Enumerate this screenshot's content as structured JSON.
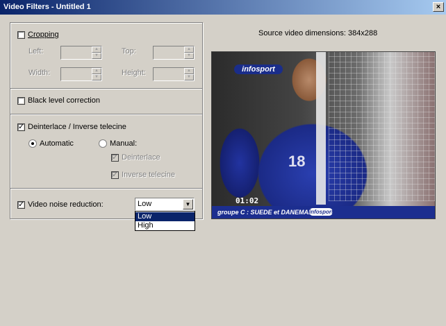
{
  "window": {
    "title": "Video Filters - Untitled 1",
    "close_glyph": "×"
  },
  "cropping": {
    "label": "Cropping",
    "checked": false,
    "left_label": "Left:",
    "top_label": "Top:",
    "width_label": "Width:",
    "height_label": "Height:",
    "left_value": "",
    "top_value": "",
    "width_value": "",
    "height_value": ""
  },
  "black_level": {
    "label": "Black level correction",
    "checked": false
  },
  "deinterlace": {
    "label": "Deinterlace / Inverse telecine",
    "checked": true,
    "automatic_label": "Automatic",
    "manual_label": "Manual:",
    "selected_mode": "Automatic",
    "deinterlace_label": "Deinterlace",
    "deinterlace_checked": true,
    "inverse_telecine_label": "Inverse telecine",
    "inverse_telecine_checked": true
  },
  "noise_reduction": {
    "label": "Video noise reduction:",
    "checked": true,
    "selected": "Low",
    "options": [
      "Low",
      "High"
    ]
  },
  "preview": {
    "dimensions_text": "Source video dimensions: 384x288",
    "overlay_logo": "infosport",
    "overlay_clock": "01:02",
    "overlay_ticker": "groupe C : SUEDE et DANEMARK",
    "overlay_brand": "infosport",
    "overlay_number": "18"
  },
  "icons": {
    "check": "✓",
    "spin_up": "▲",
    "spin_down": "▼",
    "dropdown": "▼"
  }
}
